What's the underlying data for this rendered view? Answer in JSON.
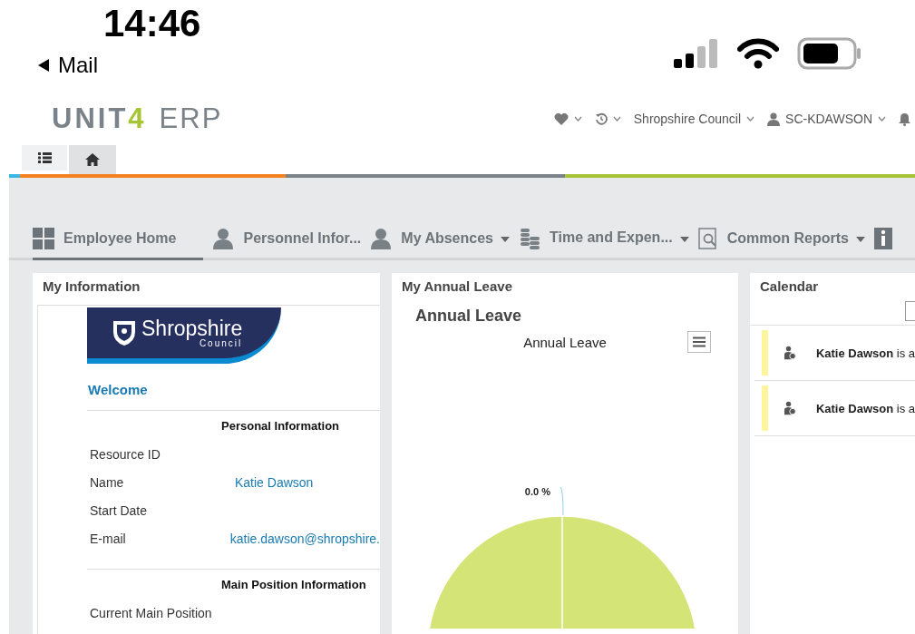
{
  "status_bar": {
    "time": "14:46",
    "back_label": "Mail"
  },
  "header": {
    "logo": "UNIT4",
    "logo_sub": "ERP",
    "menu": [
      {
        "kind": "favorites"
      },
      {
        "kind": "history"
      },
      {
        "kind": "company",
        "label": "Shropshire Council"
      },
      {
        "kind": "user",
        "label": "SC-KDAWSON"
      },
      {
        "kind": "notifications"
      }
    ]
  },
  "toolbar_tabs": [
    {
      "kind": "list",
      "selected": false
    },
    {
      "kind": "home",
      "selected": true
    }
  ],
  "nav_tabs": [
    {
      "kind": "grid",
      "label": "Employee Home",
      "selected": true,
      "has_menu": false
    },
    {
      "kind": "person",
      "label": "Personnel Infor...",
      "selected": false,
      "has_menu": false
    },
    {
      "kind": "person",
      "label": "My Absences",
      "selected": false,
      "has_menu": true
    },
    {
      "kind": "coins",
      "label": "Time and Expen...",
      "selected": false,
      "has_menu": true
    },
    {
      "kind": "report",
      "label": "Common Reports",
      "selected": false,
      "has_menu": true
    },
    {
      "kind": "info",
      "selected": false,
      "has_menu": false
    }
  ],
  "my_information": {
    "title": "My Information",
    "banner_title": "Shropshire",
    "banner_sub": "Council",
    "welcome": "Welcome",
    "sections": [
      {
        "heading": "Personal Information",
        "fields": [
          {
            "label": "Resource ID"
          },
          {
            "label": "Name",
            "value": "Katie Dawson"
          },
          {
            "label": "Start Date"
          },
          {
            "label": "E-mail",
            "value": "katie.dawson@shropshire."
          }
        ]
      },
      {
        "heading": "Main Position Information",
        "fields": [
          {
            "label": "Current Main Position"
          }
        ]
      }
    ]
  },
  "my_annual_leave": {
    "title": "My Annual Leave",
    "heading": "Annual Leave",
    "chart_title": "Annual Leave",
    "slice_label": "0.0 %"
  },
  "calendar": {
    "title": "Calendar",
    "entries": [
      {
        "text": "**Katie Dawson** is a"
      },
      {
        "text": "**Katie Dawson** is a"
      }
    ]
  }
}
